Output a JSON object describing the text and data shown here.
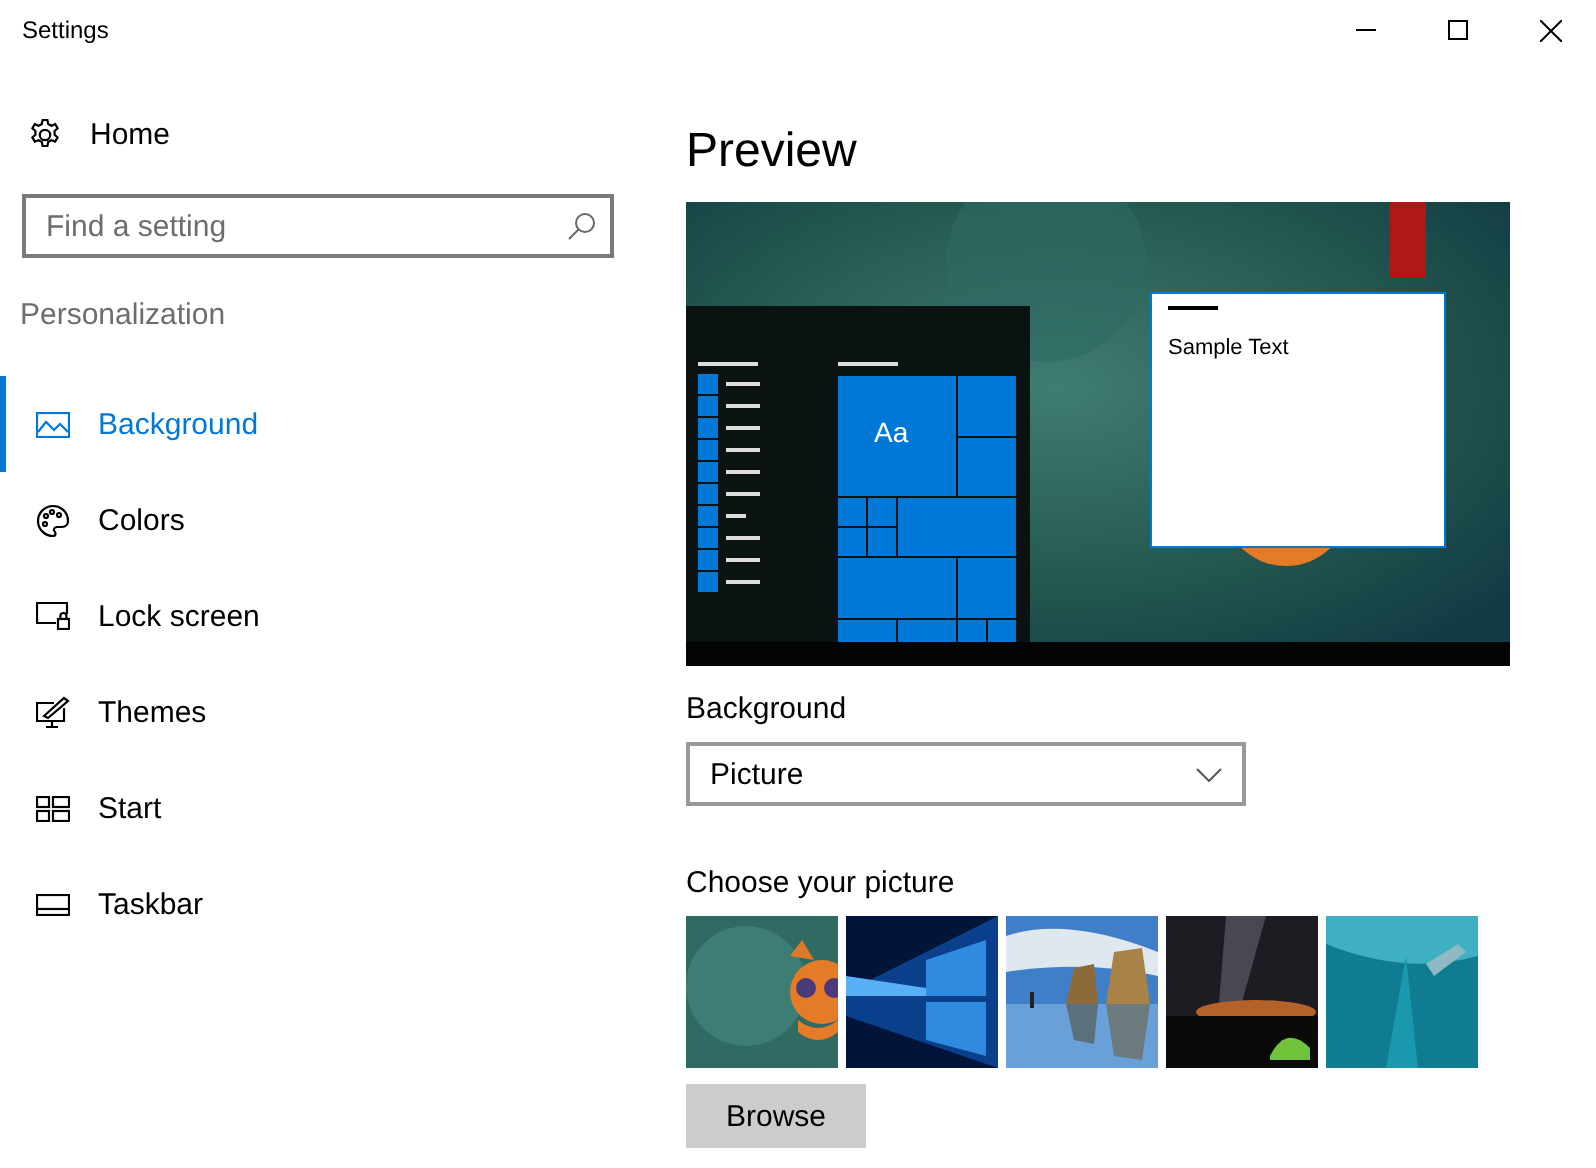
{
  "window": {
    "title": "Settings"
  },
  "sidebar": {
    "home": "Home",
    "search": {
      "placeholder": "Find a setting"
    },
    "section": "Personalization",
    "items": [
      {
        "label": "Background",
        "selected": true
      },
      {
        "label": "Colors",
        "selected": false
      },
      {
        "label": "Lock screen",
        "selected": false
      },
      {
        "label": "Themes",
        "selected": false
      },
      {
        "label": "Start",
        "selected": false
      },
      {
        "label": "Taskbar",
        "selected": false
      }
    ]
  },
  "main": {
    "heading": "Preview",
    "preview": {
      "tile_label": "Aa",
      "sample_text": "Sample Text"
    },
    "background": {
      "label": "Background",
      "value": "Picture"
    },
    "choose": {
      "label": "Choose your picture"
    },
    "browse": "Browse"
  }
}
